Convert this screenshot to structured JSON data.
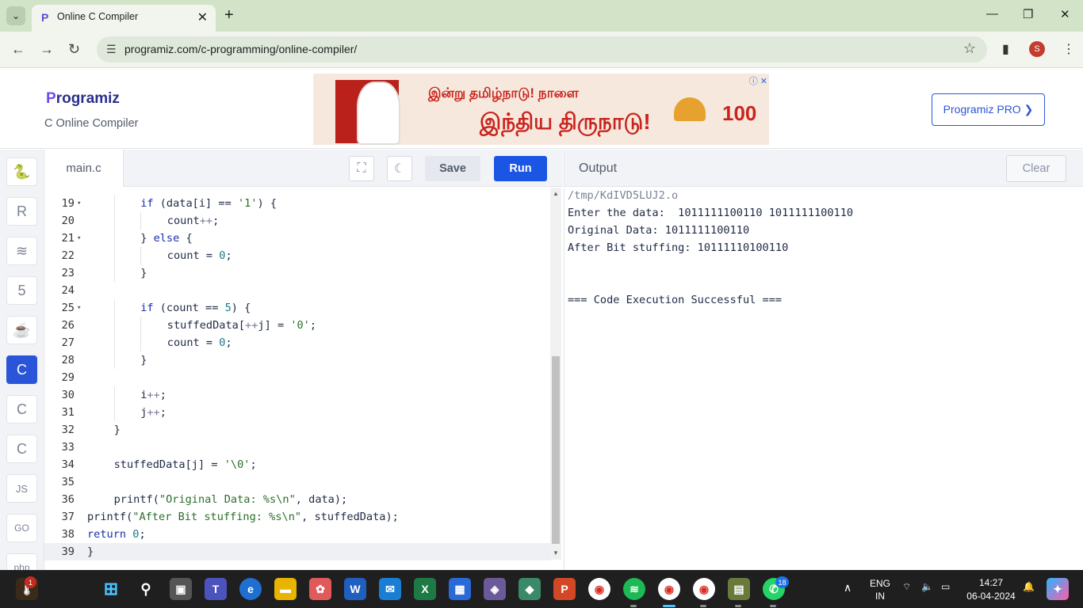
{
  "browser": {
    "tab_title": "Online C Compiler",
    "url": "programiz.com/c-programming/online-compiler/",
    "profile_initial": "S"
  },
  "header": {
    "logo_text": "rogramiz",
    "logo_letter": "P",
    "subtitle": "C Online Compiler",
    "pro_button": "Programiz PRO ❯",
    "ad": {
      "line1": "இன்று தமிழ்நாடு! நாளை",
      "line2": "இந்திய திருநாடு!",
      "badge": "100"
    }
  },
  "rail": [
    "python-icon",
    "r-icon",
    "sql-icon",
    "html-icon",
    "java-icon",
    "c-icon",
    "cpp-icon",
    "csharp-icon",
    "js-icon",
    "go-icon",
    "php-icon"
  ],
  "editor": {
    "file_tab": "main.c",
    "save": "Save",
    "run": "Run"
  },
  "code_lines": [
    {
      "n": "19",
      "fold": true,
      "indent": 2,
      "text": "if (data[i] == '1') {"
    },
    {
      "n": "20",
      "fold": false,
      "indent": 3,
      "text": "count++;"
    },
    {
      "n": "21",
      "fold": true,
      "indent": 2,
      "text": "} else {"
    },
    {
      "n": "22",
      "fold": false,
      "indent": 3,
      "text": "count = 0;"
    },
    {
      "n": "23",
      "fold": false,
      "indent": 2,
      "text": "}"
    },
    {
      "n": "24",
      "fold": false,
      "indent": 0,
      "text": ""
    },
    {
      "n": "25",
      "fold": true,
      "indent": 2,
      "text": "if (count == 5) {"
    },
    {
      "n": "26",
      "fold": false,
      "indent": 3,
      "text": "stuffedData[++j] = '0';"
    },
    {
      "n": "27",
      "fold": false,
      "indent": 3,
      "text": "count = 0;"
    },
    {
      "n": "28",
      "fold": false,
      "indent": 2,
      "text": "}"
    },
    {
      "n": "29",
      "fold": false,
      "indent": 0,
      "text": ""
    },
    {
      "n": "30",
      "fold": false,
      "indent": 2,
      "text": "i++;"
    },
    {
      "n": "31",
      "fold": false,
      "indent": 2,
      "text": "j++;"
    },
    {
      "n": "32",
      "fold": false,
      "indent": 1,
      "text": "}"
    },
    {
      "n": "33",
      "fold": false,
      "indent": 0,
      "text": ""
    },
    {
      "n": "34",
      "fold": false,
      "indent": 1,
      "text": "stuffedData[j] = '\\0';"
    },
    {
      "n": "35",
      "fold": false,
      "indent": 0,
      "text": ""
    },
    {
      "n": "36",
      "fold": false,
      "indent": 1,
      "text": "printf(\"Original Data: %s\\n\", data);"
    },
    {
      "n": "37",
      "fold": false,
      "indent": 0,
      "text": "printf(\"After Bit stuffing: %s\\n\", stuffedData);"
    },
    {
      "n": "38",
      "fold": false,
      "indent": 0,
      "text": "return 0;"
    },
    {
      "n": "39",
      "fold": false,
      "indent": 0,
      "text": "}"
    }
  ],
  "output": {
    "title": "Output",
    "clear": "Clear",
    "lines": [
      "/tmp/KdIVD5LUJ2.o",
      "Enter the data:  1011111100110 1011111100110",
      "Original Data: 1011111100110",
      "After Bit stuffing: 10111110100110",
      "",
      "",
      "=== Code Execution Successful ==="
    ]
  },
  "taskbar": {
    "lang_top": "ENG",
    "lang_bottom": "IN",
    "time": "14:27",
    "date": "06-04-2024",
    "whatsapp_badge": "18",
    "weather_badge": "1"
  }
}
